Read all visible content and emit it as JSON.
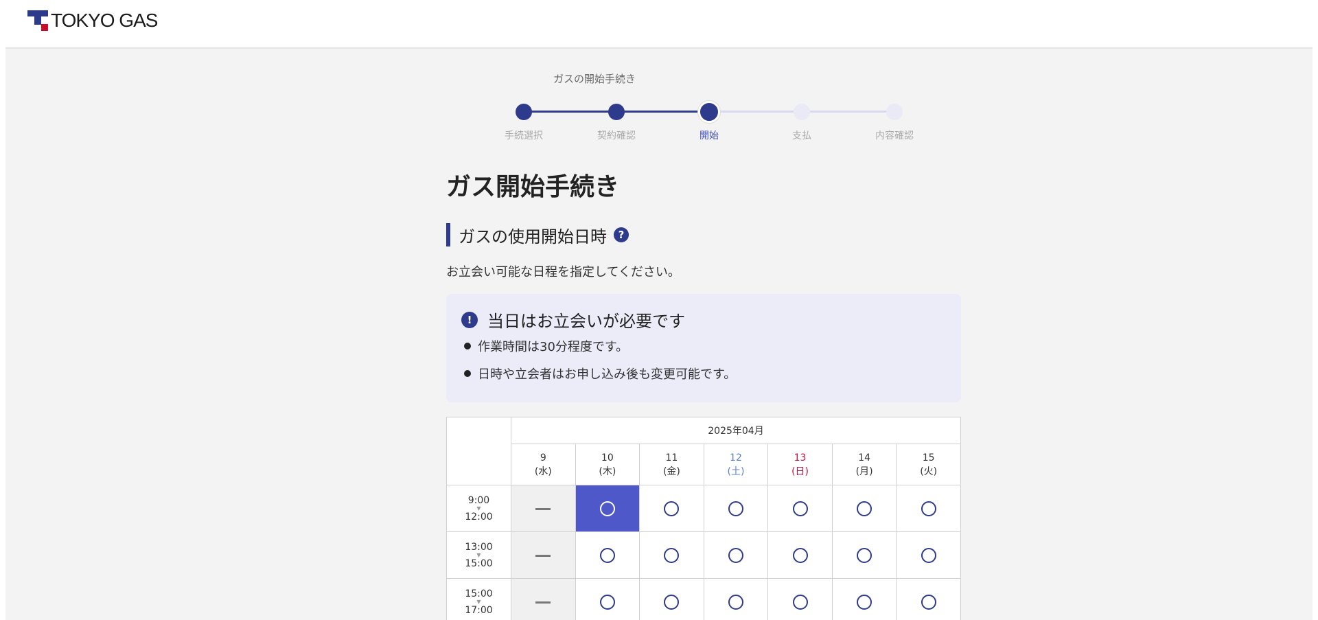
{
  "header": {
    "logo_text": "TOKYO GAS"
  },
  "stepper": {
    "heading": "ガスの開始手続き",
    "steps": [
      {
        "label": "手続選択",
        "state": "done"
      },
      {
        "label": "契約確認",
        "state": "done"
      },
      {
        "label": "開始",
        "state": "current"
      },
      {
        "label": "支払",
        "state": "todo"
      },
      {
        "label": "内容確認",
        "state": "todo"
      }
    ]
  },
  "page": {
    "title": "ガス開始手続き",
    "section_title": "ガスの使用開始日時",
    "help_icon": "?",
    "lead": "お立会い可能な日程を指定してください。"
  },
  "notice": {
    "icon": "!",
    "title": "当日はお立会いが必要です",
    "items": [
      "作業時間は30分程度です。",
      "日時や立会者はお申し込み後も変更可能です。"
    ]
  },
  "calendar": {
    "month": "2025年04月",
    "days": [
      {
        "date": "9",
        "weekday": "(水)",
        "type": "weekday"
      },
      {
        "date": "10",
        "weekday": "(木)",
        "type": "weekday"
      },
      {
        "date": "11",
        "weekday": "(金)",
        "type": "weekday"
      },
      {
        "date": "12",
        "weekday": "(土)",
        "type": "sat"
      },
      {
        "date": "13",
        "weekday": "(日)",
        "type": "sun"
      },
      {
        "date": "14",
        "weekday": "(月)",
        "type": "weekday"
      },
      {
        "date": "15",
        "weekday": "(火)",
        "type": "weekday"
      }
    ],
    "time_arrow": "▼",
    "slots": [
      {
        "start": "9:00",
        "end": "12:00",
        "cells": [
          "na",
          "selected",
          "open",
          "open",
          "open",
          "open",
          "open"
        ]
      },
      {
        "start": "13:00",
        "end": "15:00",
        "cells": [
          "na",
          "open",
          "open",
          "open",
          "open",
          "open",
          "open"
        ]
      },
      {
        "start": "15:00",
        "end": "17:00",
        "cells": [
          "na",
          "open",
          "open",
          "open",
          "open",
          "open",
          "open"
        ]
      }
    ]
  },
  "colors": {
    "brand": "#2e3a8c",
    "selected": "#4f58c9",
    "notice_bg": "#ebecf8",
    "saturday": "#5b7fd6",
    "sunday": "#c0143c"
  }
}
